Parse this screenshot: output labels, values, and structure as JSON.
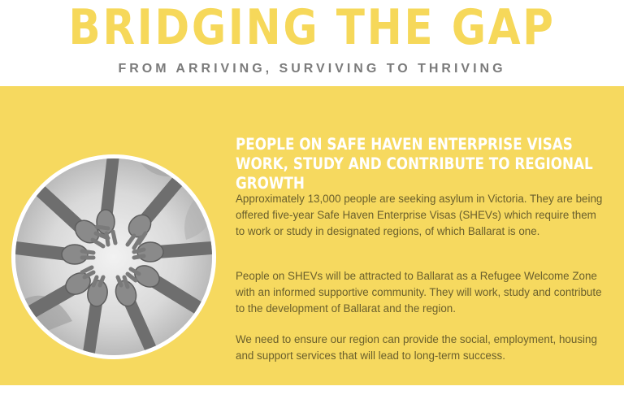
{
  "header": {
    "title": "BRIDGING THE GAP",
    "subtitle": "FROM ARRIVING, SURVIVING TO THRIVING"
  },
  "main": {
    "headline": "PEOPLE ON SAFE HAVEN ENTERPRISE VISAS WORK, STUDY AND CONTRIBUTE TO REGIONAL GROWTH",
    "paragraphs": [
      "Approximately 13,000 people are seeking asylum in Victoria. They are being offered five-year Safe Haven Enterprise Visas (SHEVs) which require them to work or study in designated regions, of which Ballarat is one.",
      "People on SHEVs will be attracted to Ballarat as a Refugee Welcome Zone with an informed supportive community. They will work, study and contribute to the development of Ballarat and the region.",
      "We need to ensure our region can provide the social, employment, housing and support services that will lead to long-term success."
    ]
  },
  "colors": {
    "accent_yellow": "#f6d95f",
    "title_yellow": "#f6d85a",
    "subtitle_gray": "#7b7b7b",
    "body_text": "#6a5f2c"
  }
}
